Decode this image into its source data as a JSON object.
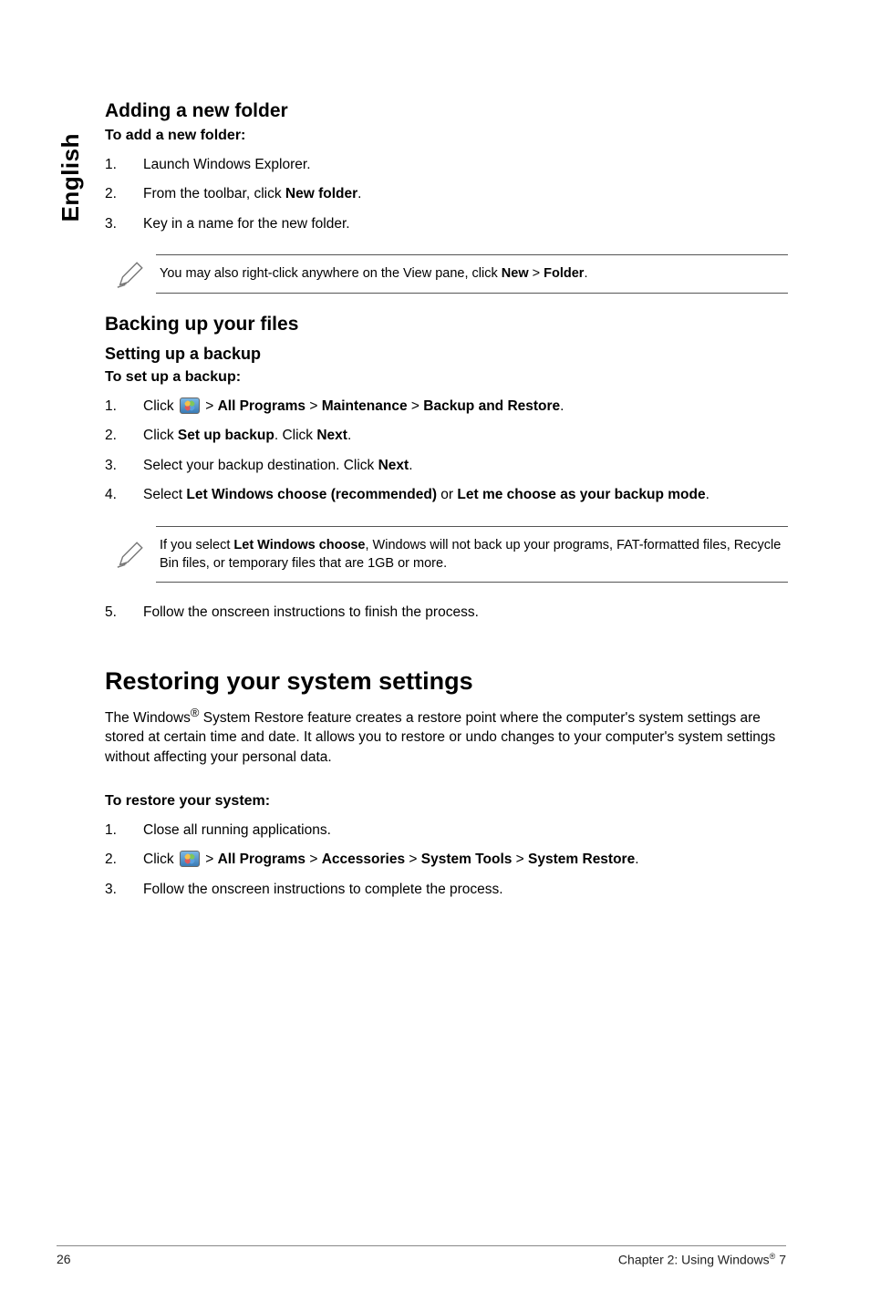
{
  "sidebar": {
    "language": "English"
  },
  "section_add": {
    "heading": "Adding a new folder",
    "intro": "To add a new folder:",
    "steps": [
      {
        "n": "1.",
        "text": "Launch Windows Explorer."
      },
      {
        "n": "2.",
        "prefix": "From the toolbar, click ",
        "bold": "New folder",
        "suffix": "."
      },
      {
        "n": "3.",
        "text": "Key in a name for the new folder."
      }
    ],
    "note": {
      "prefix": "You may also right-click anywhere on the View pane, click ",
      "b1": "New",
      "mid": " > ",
      "b2": "Folder",
      "suffix": "."
    }
  },
  "section_backup": {
    "heading": "Backing up your files",
    "sub": "Setting up a backup",
    "intro": "To set up a backup:",
    "steps": {
      "s1": {
        "n": "1.",
        "pre": "Click ",
        "chain": [
          " > ",
          "All Programs",
          " > ",
          "Maintenance",
          " > ",
          "Backup and Restore",
          "."
        ]
      },
      "s2": {
        "n": "2.",
        "pre": "Click ",
        "b1": "Set up backup",
        "mid": ". Click ",
        "b2": "Next",
        "suf": "."
      },
      "s3": {
        "n": "3.",
        "pre": "Select your backup destination. Click ",
        "b1": "Next",
        "suf": "."
      },
      "s4": {
        "n": "4.",
        "pre": "Select ",
        "b1": "Let Windows choose (recommended)",
        "mid": " or ",
        "b2": "Let me choose as your backup mode",
        "suf": "."
      }
    },
    "note": {
      "pre": "If you select ",
      "b1": "Let Windows choose",
      "suf": ", Windows will not back up your programs, FAT-formatted files, Recycle Bin files, or temporary files that are 1GB or more."
    },
    "s5": {
      "n": "5.",
      "text": "Follow the onscreen instructions to finish the process."
    }
  },
  "section_restore": {
    "heading": "Restoring your system settings",
    "para_pre": "The Windows",
    "para_sup": "®",
    "para_post": " System Restore feature creates a restore point where the computer's system settings are stored at certain time and date. It allows you to restore or undo changes to your computer's system settings without affecting your personal data.",
    "intro": "To restore your system:",
    "steps": {
      "s1": {
        "n": "1.",
        "text": "Close all running applications."
      },
      "s2": {
        "n": "2.",
        "pre": "Click ",
        "chain": [
          " > ",
          "All Programs",
          " > ",
          "Accessories",
          " > ",
          "System Tools",
          " > ",
          "System Restore",
          "."
        ]
      },
      "s3": {
        "n": "3.",
        "text": "Follow the onscreen instructions to complete the process."
      }
    }
  },
  "footer": {
    "page": "26",
    "chapter_pre": "Chapter 2: Using Windows",
    "chapter_sup": "®",
    "chapter_post": " 7"
  }
}
